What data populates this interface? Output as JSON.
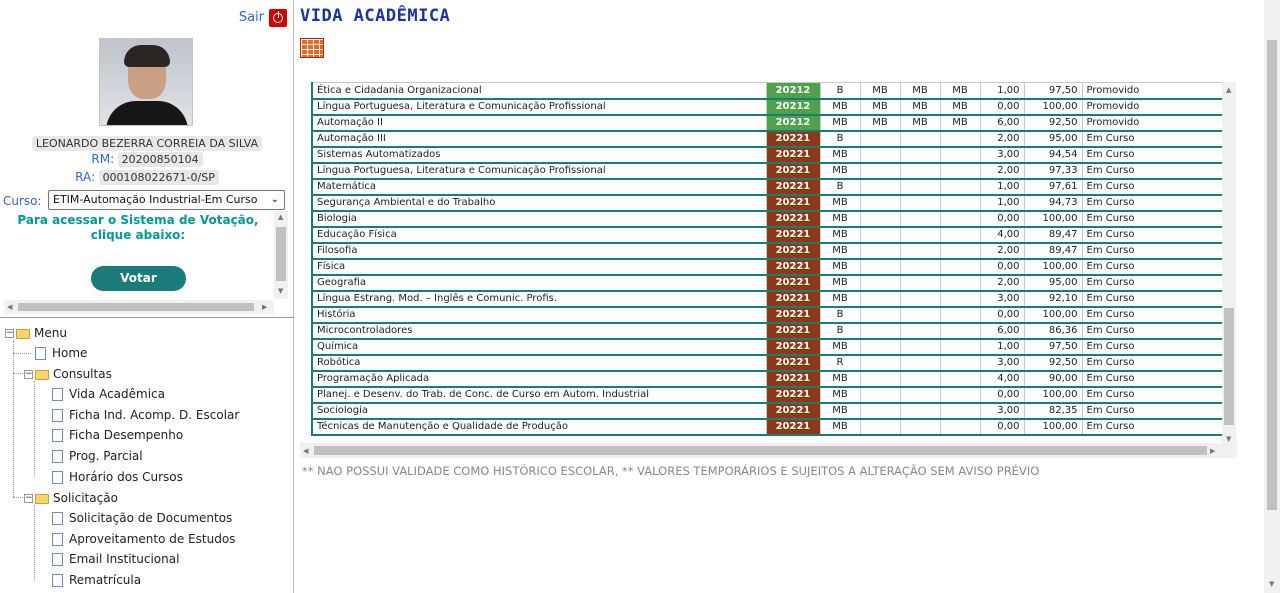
{
  "profile": {
    "sair_label": "Sair",
    "student_name": "LEONARDO BEZERRA CORREIA DA SILVA",
    "rm_label": "RM:",
    "rm_value": "20200850104",
    "ra_label": "RA:",
    "ra_value": "000108022671-0/SP",
    "curso_label": "Curso:",
    "curso_value": "ETIM-Automação Industrial-Em Curso",
    "vote_message_line1": "Para acessar o Sistema de Votação,",
    "vote_message_line2": "clique abaixo:",
    "vote_button": "Votar"
  },
  "tree": {
    "root": "Menu",
    "home": "Home",
    "consultas": {
      "label": "Consultas",
      "items": [
        "Vida Acadêmica",
        "Ficha Ind. Acomp. D. Escolar",
        "Ficha Desempenho",
        "Prog. Parcial",
        "Horário dos Cursos"
      ]
    },
    "solicitacao": {
      "label": "Solicitação",
      "items": [
        "Solicitação de Documentos",
        "Aproveitamento de Estudos",
        "Email Institucional",
        "Rematrícula"
      ]
    }
  },
  "page_title": "VIDA ACADÊMICA",
  "grid_icon": "table-grid-icon",
  "colors": {
    "title": "#1a33a6",
    "accent": "#1b7a7a",
    "year_promoted": "#4ea24a",
    "year_current": "#8b3a14",
    "logout": "#d40000"
  },
  "rows": [
    {
      "subject": "Ética e Cidadania Organizacional",
      "year": "20212",
      "n1": "B",
      "n2": "MB",
      "n3": "MB",
      "n4": "MB",
      "faltas": "1,00",
      "freq": "97,50",
      "status": "Promovido"
    },
    {
      "subject": "Língua Portuguesa, Literatura e Comunicação Profissional",
      "year": "20212",
      "n1": "MB",
      "n2": "MB",
      "n3": "MB",
      "n4": "MB",
      "faltas": "0,00",
      "freq": "100,00",
      "status": "Promovido"
    },
    {
      "subject": "Automação II",
      "year": "20212",
      "n1": "MB",
      "n2": "MB",
      "n3": "MB",
      "n4": "MB",
      "faltas": "6,00",
      "freq": "92,50",
      "status": "Promovido"
    },
    {
      "subject": "Automação III",
      "year": "20221",
      "n1": "B",
      "n2": "",
      "n3": "",
      "n4": "",
      "faltas": "2,00",
      "freq": "95,00",
      "status": "Em Curso"
    },
    {
      "subject": "Sistemas Automatizados",
      "year": "20221",
      "n1": "MB",
      "n2": "",
      "n3": "",
      "n4": "",
      "faltas": "3,00",
      "freq": "94,54",
      "status": "Em Curso"
    },
    {
      "subject": "Língua Portuguesa, Literatura e Comunicação Profissional",
      "year": "20221",
      "n1": "MB",
      "n2": "",
      "n3": "",
      "n4": "",
      "faltas": "2,00",
      "freq": "97,33",
      "status": "Em Curso"
    },
    {
      "subject": "Matemática",
      "year": "20221",
      "n1": "B",
      "n2": "",
      "n3": "",
      "n4": "",
      "faltas": "1,00",
      "freq": "97,61",
      "status": "Em Curso"
    },
    {
      "subject": "Segurança Ambiental e do Trabalho",
      "year": "20221",
      "n1": "MB",
      "n2": "",
      "n3": "",
      "n4": "",
      "faltas": "1,00",
      "freq": "94,73",
      "status": "Em Curso"
    },
    {
      "subject": "Biologia",
      "year": "20221",
      "n1": "MB",
      "n2": "",
      "n3": "",
      "n4": "",
      "faltas": "0,00",
      "freq": "100,00",
      "status": "Em Curso"
    },
    {
      "subject": "Educação Física",
      "year": "20221",
      "n1": "MB",
      "n2": "",
      "n3": "",
      "n4": "",
      "faltas": "4,00",
      "freq": "89,47",
      "status": "Em Curso"
    },
    {
      "subject": "Filosofia",
      "year": "20221",
      "n1": "MB",
      "n2": "",
      "n3": "",
      "n4": "",
      "faltas": "2,00",
      "freq": "89,47",
      "status": "Em Curso"
    },
    {
      "subject": "Física",
      "year": "20221",
      "n1": "MB",
      "n2": "",
      "n3": "",
      "n4": "",
      "faltas": "0,00",
      "freq": "100,00",
      "status": "Em Curso"
    },
    {
      "subject": "Geografia",
      "year": "20221",
      "n1": "MB",
      "n2": "",
      "n3": "",
      "n4": "",
      "faltas": "2,00",
      "freq": "95,00",
      "status": "Em Curso"
    },
    {
      "subject": "Língua Estrang. Mod. – Inglês e Comunic. Profis.",
      "year": "20221",
      "n1": "MB",
      "n2": "",
      "n3": "",
      "n4": "",
      "faltas": "3,00",
      "freq": "92,10",
      "status": "Em Curso"
    },
    {
      "subject": "História",
      "year": "20221",
      "n1": "B",
      "n2": "",
      "n3": "",
      "n4": "",
      "faltas": "0,00",
      "freq": "100,00",
      "status": "Em Curso"
    },
    {
      "subject": "Microcontroladores",
      "year": "20221",
      "n1": "B",
      "n2": "",
      "n3": "",
      "n4": "",
      "faltas": "6,00",
      "freq": "86,36",
      "status": "Em Curso"
    },
    {
      "subject": "Química",
      "year": "20221",
      "n1": "MB",
      "n2": "",
      "n3": "",
      "n4": "",
      "faltas": "1,00",
      "freq": "97,50",
      "status": "Em Curso"
    },
    {
      "subject": "Robótica",
      "year": "20221",
      "n1": "R",
      "n2": "",
      "n3": "",
      "n4": "",
      "faltas": "3,00",
      "freq": "92,50",
      "status": "Em Curso"
    },
    {
      "subject": "Programação Aplicada",
      "year": "20221",
      "n1": "MB",
      "n2": "",
      "n3": "",
      "n4": "",
      "faltas": "4,00",
      "freq": "90,00",
      "status": "Em Curso"
    },
    {
      "subject": "Planej. e Desenv. do Trab. de Conc. de Curso em Autom. Industrial",
      "year": "20221",
      "n1": "MB",
      "n2": "",
      "n3": "",
      "n4": "",
      "faltas": "0,00",
      "freq": "100,00",
      "status": "Em Curso"
    },
    {
      "subject": "Sociologia",
      "year": "20221",
      "n1": "MB",
      "n2": "",
      "n3": "",
      "n4": "",
      "faltas": "3,00",
      "freq": "82,35",
      "status": "Em Curso"
    },
    {
      "subject": "Técnicas de Manutenção e Qualidade de Produção",
      "year": "20221",
      "n1": "MB",
      "n2": "",
      "n3": "",
      "n4": "",
      "faltas": "0,00",
      "freq": "100,00",
      "status": "Em Curso"
    }
  ],
  "disclaimer": "** NAO POSSUI VALIDADE COMO HISTÓRICO ESCOLAR, ** VALORES TEMPORÁRIOS E SUJEITOS A ALTERAÇÃO SEM AVISO PRÉVIO"
}
